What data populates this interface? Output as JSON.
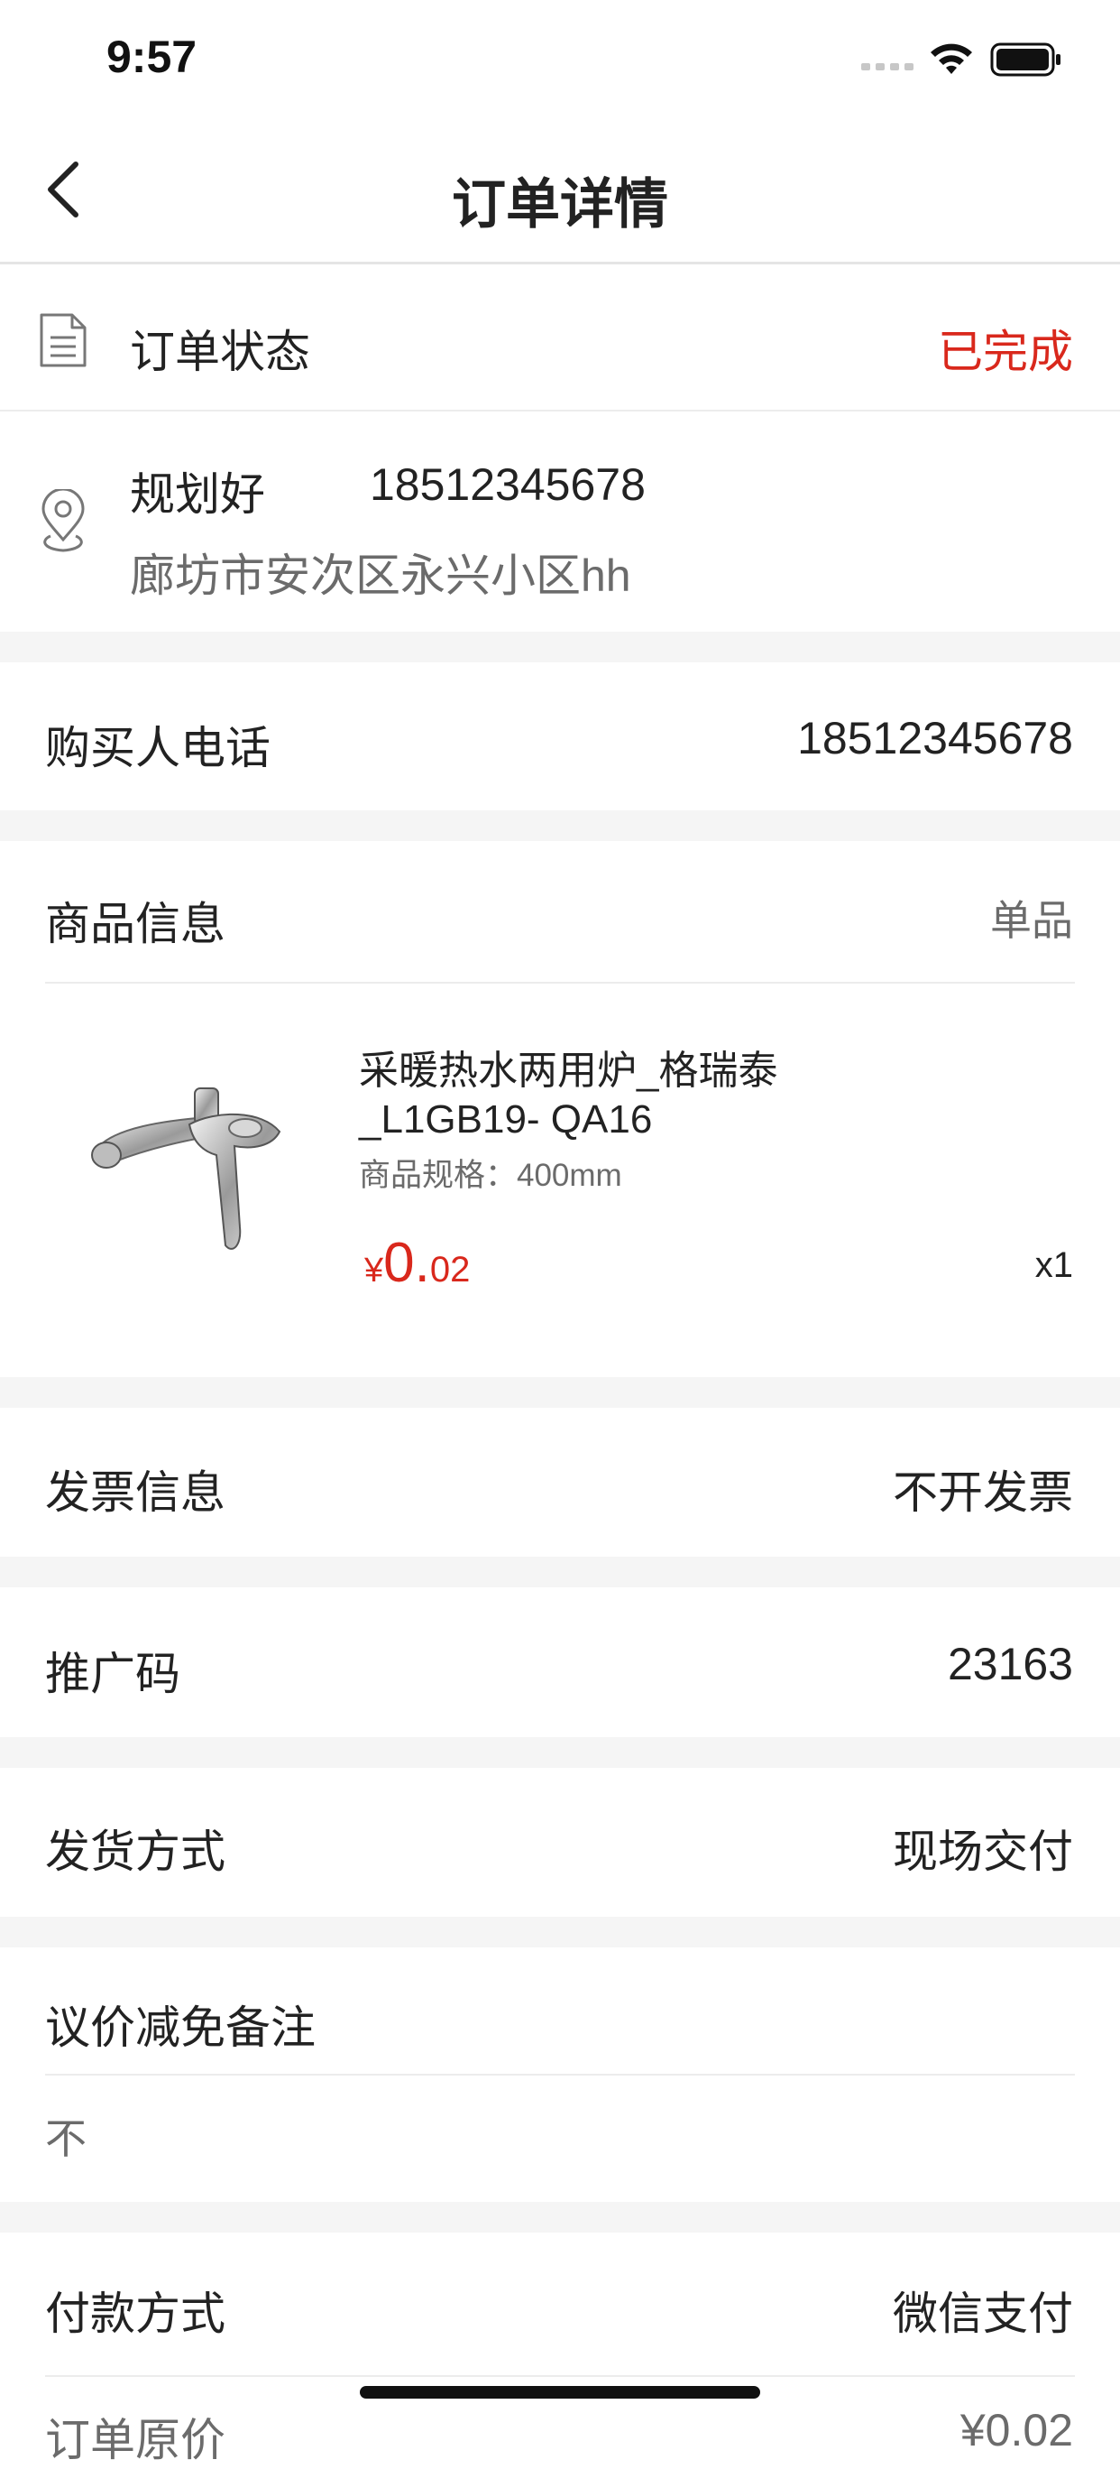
{
  "status_bar": {
    "time": "9:57"
  },
  "nav": {
    "title": "订单详情"
  },
  "order_status": {
    "label": "订单状态",
    "value": "已完成"
  },
  "address": {
    "name": "规划好",
    "phone": "18512345678",
    "detail": "廊坊市安次区永兴小区hh"
  },
  "buyer_phone": {
    "label": "购买人电话",
    "value": "18512345678"
  },
  "product_info": {
    "label": "商品信息",
    "type": "单品",
    "item": {
      "name_line1": "采暖热水两用炉_格瑞泰",
      "name_line2": "_L1GB19- QA16",
      "spec": "商品规格：400mm",
      "price_symbol": "¥",
      "price_int": "0.",
      "price_dec": "02",
      "quantity": "x1"
    }
  },
  "invoice": {
    "label": "发票信息",
    "value": "不开发票"
  },
  "promo_code": {
    "label": "推广码",
    "value": "23163"
  },
  "shipping": {
    "label": "发货方式",
    "value": "现场交付"
  },
  "discount_note": {
    "label": "议价减免备注",
    "value": "不"
  },
  "payment": {
    "label": "付款方式",
    "value": "微信支付"
  },
  "original_price": {
    "label": "订单原价",
    "value": "¥0.02"
  },
  "colors": {
    "accent_red": "#d9281c",
    "background_gray": "#f5f5f5"
  }
}
